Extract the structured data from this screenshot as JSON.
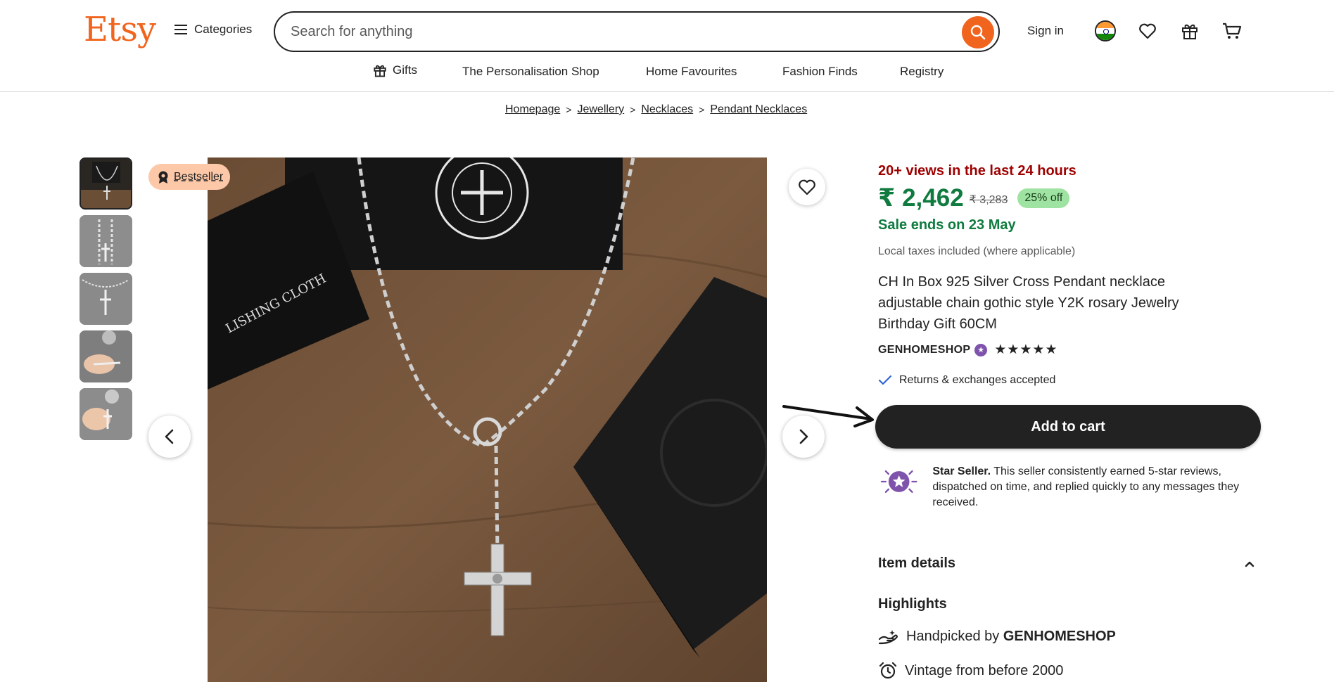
{
  "header": {
    "logo": "Etsy",
    "categories_label": "Categories",
    "search_placeholder": "Search for anything",
    "signin_label": "Sign in"
  },
  "subnav": {
    "items": [
      {
        "label": "Gifts",
        "icon": "gift-icon"
      },
      {
        "label": "The Personalisation Shop"
      },
      {
        "label": "Home Favourites"
      },
      {
        "label": "Fashion Finds"
      },
      {
        "label": "Registry"
      }
    ]
  },
  "breadcrumb": [
    "Homepage",
    "Jewellery",
    "Necklaces",
    "Pendant Necklaces"
  ],
  "gallery": {
    "badge": "Bestseller",
    "thumbnail_count": 5
  },
  "product": {
    "views": "20+ views in the last 24 hours",
    "price": "₹ 2,462",
    "original_price": "₹ 3,283",
    "discount": "25% off",
    "sale_ends": "Sale ends on 23 May",
    "taxes": "Local taxes included (where applicable)",
    "title": "CH In Box 925 Silver Cross Pendant necklace adjustable chain gothic style Y2K rosary Jewelry Birthday Gift 60CM",
    "shop_name": "GENHOMESHOP",
    "stars": "★★★★★",
    "rating": 5,
    "returns": "Returns & exchanges accepted",
    "add_to_cart": "Add to cart",
    "star_seller_title": "Star Seller.",
    "star_seller_text": " This seller consistently earned 5-star reviews, dispatched on time, and replied quickly to any messages they received.",
    "item_details": "Item details",
    "highlights": "Highlights",
    "highlight_1_prefix": "Handpicked by ",
    "highlight_1_shop": "GENHOMESHOP",
    "highlight_2": "Vintage from before 2000"
  },
  "colors": {
    "brand": "#f1641e",
    "price_green": "#0f7b3f",
    "views_red": "#9e0000",
    "discount_bg": "#9ee3a1",
    "badge_bg": "#fcc8a8",
    "star_seller_purple": "#7f53ac"
  }
}
